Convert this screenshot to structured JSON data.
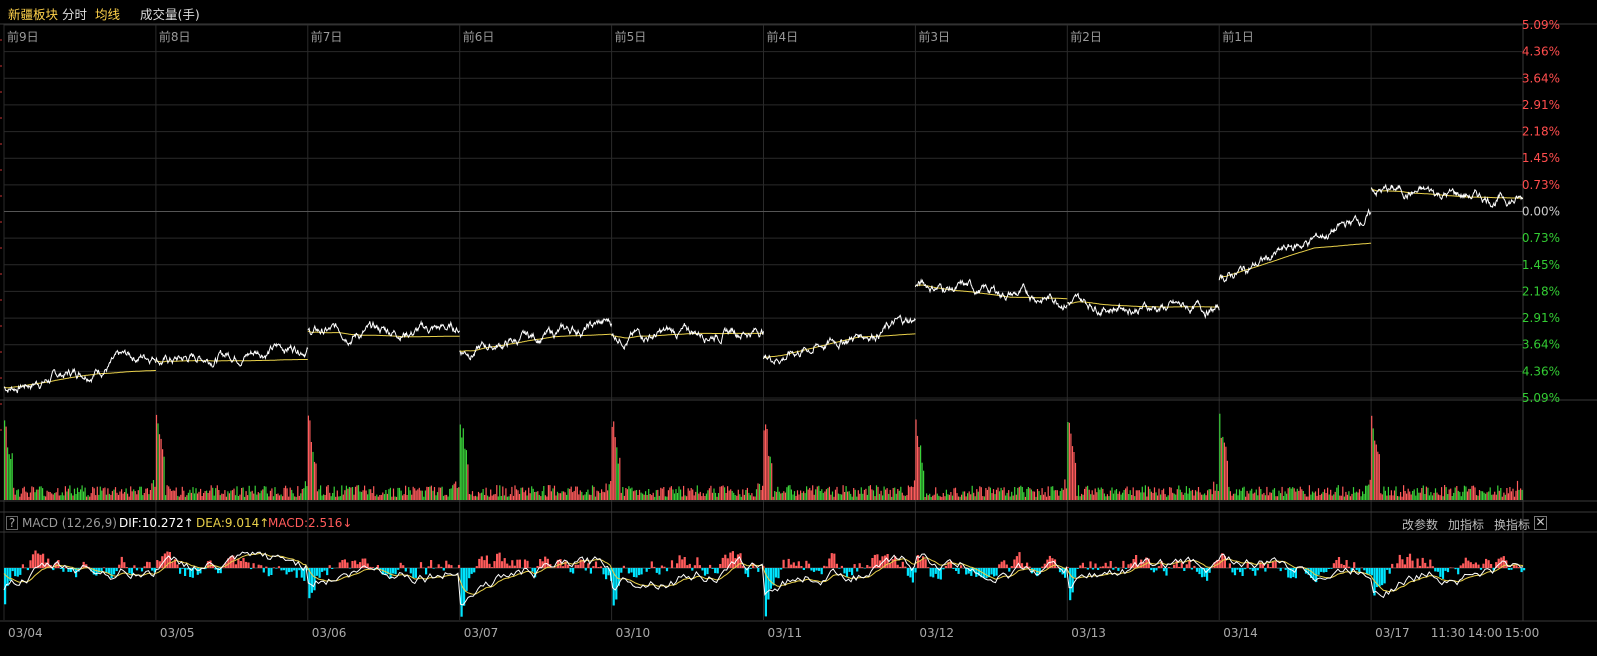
{
  "header": {
    "sector_name": "新疆板块",
    "mode_label": "分时",
    "avg_label": "均线",
    "volume_label": "成交量(手)"
  },
  "colors": {
    "price_line": "#ffffff",
    "avg_line": "#e8d04a",
    "up": "#ff5b5b",
    "down": "#3ad13a",
    "macd_neg": "#00e5ff",
    "grid": "#2a2a2a",
    "axis_up_text": "#ff4d4d",
    "axis_down_text": "#33cc33"
  },
  "day_labels": [
    "前9日",
    "前8日",
    "前7日",
    "前6日",
    "前5日",
    "前4日",
    "前3日",
    "前2日",
    "前1日"
  ],
  "x_axis": {
    "dates": [
      "03/04",
      "03/05",
      "03/06",
      "03/07",
      "03/10",
      "03/11",
      "03/12",
      "03/13",
      "03/14",
      "03/17"
    ],
    "intraday_ticks": [
      "11:30",
      "14:00",
      "15:00"
    ]
  },
  "price_axis": {
    "labels": [
      "5.09%",
      "4.36%",
      "3.64%",
      "2.91%",
      "2.18%",
      "1.45%",
      "0.73%",
      "0.00%",
      "0.73%",
      "1.45%",
      "2.18%",
      "2.91%",
      "3.64%",
      "4.36%",
      "5.09%"
    ],
    "range_pct": [
      -5.09,
      5.09
    ]
  },
  "macd": {
    "title": "MACD (12,26,9)",
    "dif_text": "DIF:10.272↑",
    "dea_text": "DEA:9.014↑",
    "macd_text": "MACD:2.516↓",
    "dif": 10.272,
    "dea": 9.014,
    "value": 2.516,
    "buttons": {
      "params": "改参数",
      "add_indicator": "加指标",
      "switch_indicator": "换指标"
    },
    "help_label": "?",
    "close_label": "✕"
  },
  "chart_data": {
    "type": "line",
    "title": "",
    "x": [
      "03/04",
      "03/05",
      "03/06",
      "03/07",
      "03/10",
      "03/11",
      "03/12",
      "03/13",
      "03/14",
      "03/17"
    ],
    "series": [
      {
        "values_pct_open": [
          -4.8,
          -4.1,
          -3.3,
          -3.8,
          -3.4,
          -4.0,
          -2.0,
          -2.5,
          -1.8,
          0.6
        ]
      },
      {
        "values_pct_close": [
          -3.8,
          -3.6,
          -3.2,
          -3.0,
          -3.2,
          -2.9,
          -2.4,
          -2.7,
          0.0,
          0.3
        ]
      },
      {
        "values_pct_avg_end": [
          -4.3,
          -4.1,
          -3.5,
          -3.3,
          -3.3,
          -3.2,
          -2.5,
          -2.6,
          -0.8,
          0.3
        ]
      }
    ],
    "ylabel": "",
    "xlabel": "",
    "ylim": [
      -5.09,
      5.09
    ],
    "grid": true
  }
}
